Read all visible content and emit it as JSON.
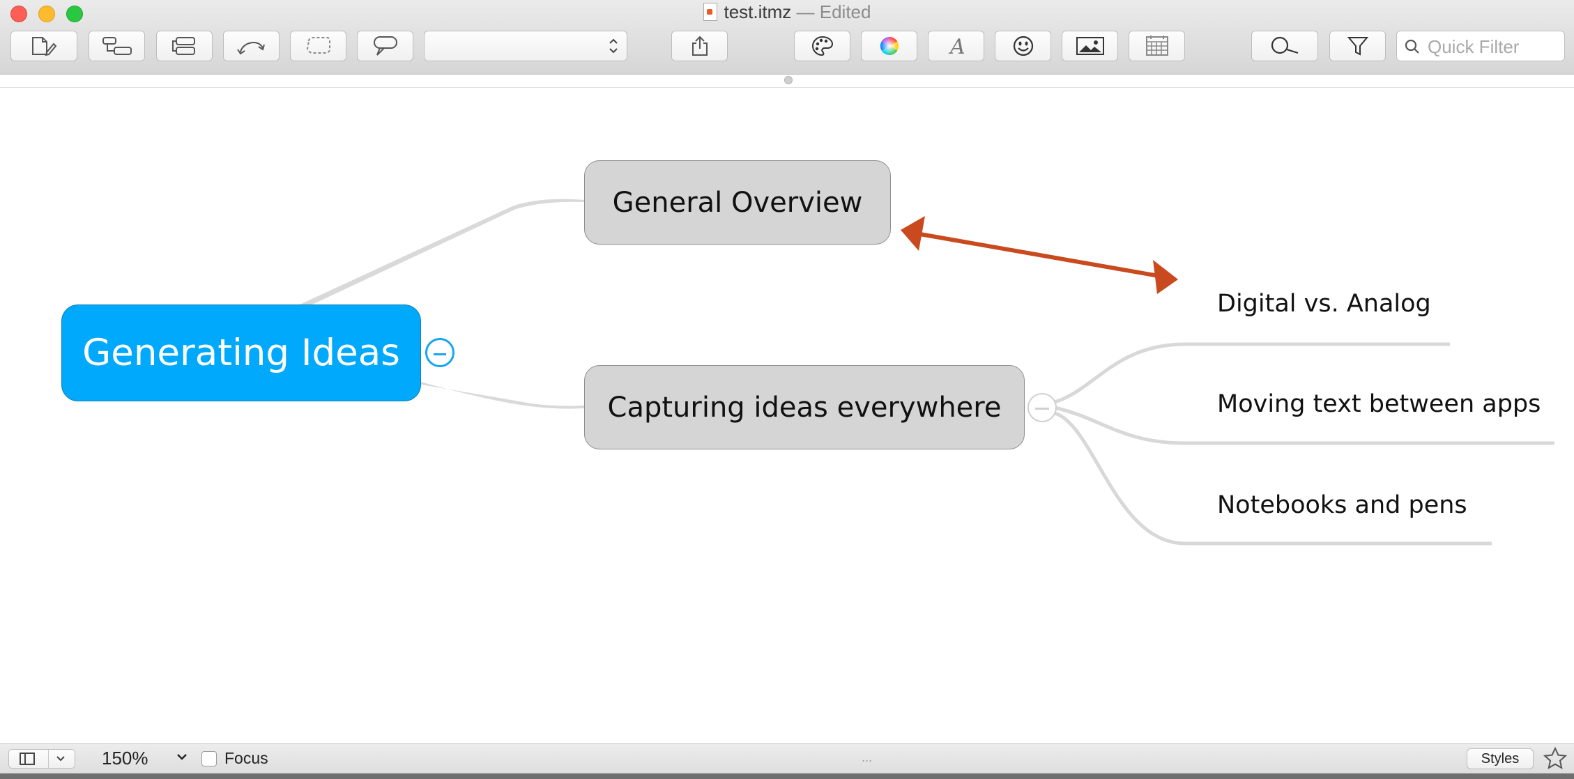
{
  "window": {
    "title": "test.itmz",
    "edited_suffix": "— Edited"
  },
  "toolbar": {
    "style_popup_value": "",
    "search_placeholder": "Quick Filter",
    "icons": [
      "new-topic-icon",
      "sibling-topic-icon",
      "child-topic-icon",
      "relationship-icon",
      "boundary-icon",
      "callout-icon",
      "share-icon",
      "palette-icon",
      "color-wheel-icon",
      "font-icon",
      "emoji-icon",
      "image-icon",
      "calendar-icon",
      "search-icon",
      "filter-icon"
    ]
  },
  "mindmap": {
    "root": "Generating Ideas",
    "children": [
      {
        "label": "General Overview"
      },
      {
        "label": "Capturing ideas everywhere",
        "children": [
          "Digital vs. Analog",
          "Moving text between apps",
          "Notebooks and pens"
        ]
      }
    ],
    "colors": {
      "root_fill": "#00a9fb",
      "topic_fill": "#d5d5d5",
      "relationship": "#c94a1e",
      "branch": "#d9d9d9"
    }
  },
  "statusbar": {
    "zoom": "150%",
    "focus_label": "Focus",
    "focus_checked": false,
    "ellipsis": "...",
    "styles_label": "Styles"
  }
}
